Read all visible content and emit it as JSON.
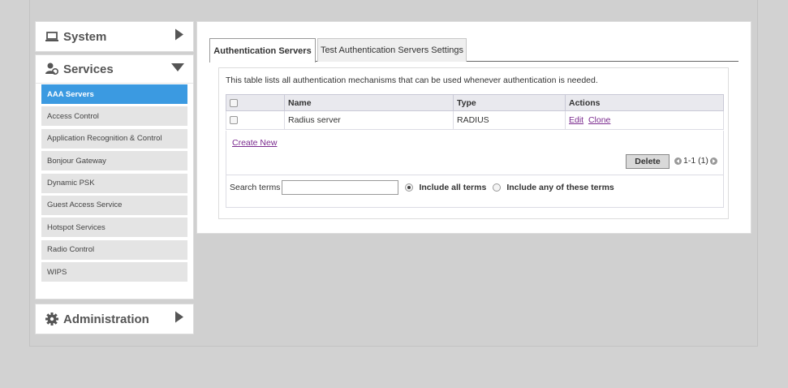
{
  "sidebar": {
    "system": {
      "label": "System"
    },
    "services": {
      "label": "Services",
      "items": [
        {
          "label": "AAA Servers",
          "active": true
        },
        {
          "label": "Access Control"
        },
        {
          "label": "Application Recognition & Control"
        },
        {
          "label": "Bonjour Gateway"
        },
        {
          "label": "Dynamic PSK"
        },
        {
          "label": "Guest Access Service"
        },
        {
          "label": "Hotspot Services"
        },
        {
          "label": "Radio Control"
        },
        {
          "label": "WIPS"
        }
      ]
    },
    "administration": {
      "label": "Administration"
    }
  },
  "tabs": [
    {
      "label": "Authentication Servers",
      "active": true
    },
    {
      "label": "Test Authentication Servers Settings"
    }
  ],
  "panel": {
    "description": "This table lists all authentication mechanisms that can be used whenever authentication is needed.",
    "columns": [
      "Name",
      "Type",
      "Actions"
    ],
    "rows": [
      {
        "name": "Radius server",
        "type": "RADIUS",
        "actions": [
          "Edit",
          "Clone"
        ]
      }
    ],
    "create_new": "Create New",
    "delete_label": "Delete",
    "pager_text": "1-1 (1)",
    "search": {
      "label": "Search terms",
      "value": "",
      "option_all": "Include all terms",
      "option_any": "Include any of these terms",
      "selected": "all"
    }
  },
  "colors": {
    "accent": "#3b9ae1",
    "link": "#7a2a8e"
  }
}
